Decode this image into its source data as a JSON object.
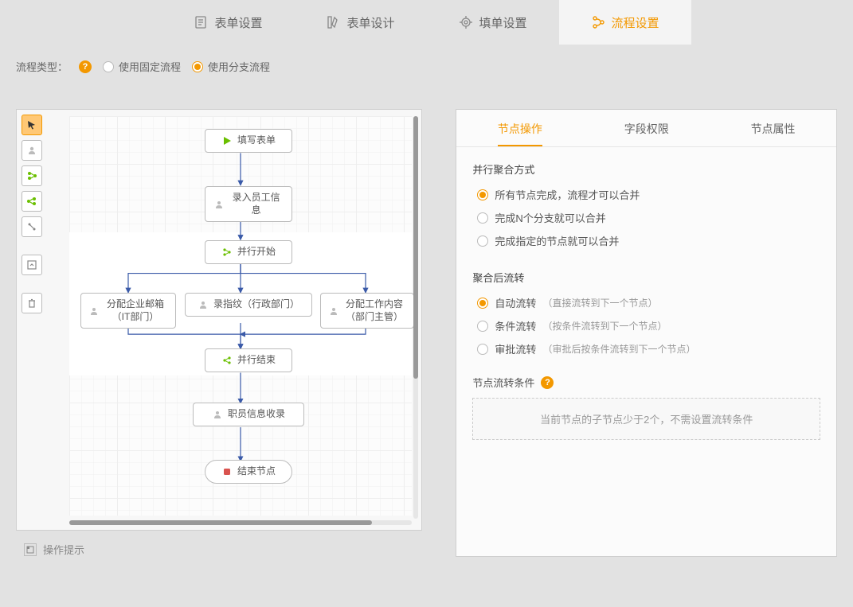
{
  "tabs": {
    "form_settings": "表单设置",
    "form_design": "表单设计",
    "fill_settings": "填单设置",
    "process_settings": "流程设置"
  },
  "process_type": {
    "label": "流程类型：",
    "fixed": "使用固定流程",
    "branch": "使用分支流程"
  },
  "nodes": {
    "fill_form": "填写表单",
    "enter_employee": "录入员工信息",
    "parallel_start": "并行开始",
    "assign_email": "分配企业邮箱（IT部门）",
    "fingerprint": "录指纹（行政部门）",
    "assign_work": "分配工作内容（部门主管）",
    "parallel_end": "并行结束",
    "employee_record": "职员信息收录",
    "end_node": "结束节点"
  },
  "right": {
    "tabs": {
      "node_op": "节点操作",
      "field_perm": "字段权限",
      "node_attr": "节点属性"
    },
    "merge": {
      "title": "并行聚合方式",
      "all_done": "所有节点完成，流程才可以合并",
      "n_done": "完成N个分支就可以合并",
      "specific": "完成指定的节点就可以合并"
    },
    "post": {
      "title": "聚合后流转",
      "auto": "自动流转",
      "auto_desc": "（直接流转到下一个节点）",
      "cond": "条件流转",
      "cond_desc": "（按条件流转到下一个节点）",
      "approve": "审批流转",
      "approve_desc": "（审批后按条件流转到下一个节点）"
    },
    "cond_title": "节点流转条件",
    "cond_box": "当前节点的子节点少于2个，不需设置流转条件"
  },
  "op_hint": "操作提示"
}
